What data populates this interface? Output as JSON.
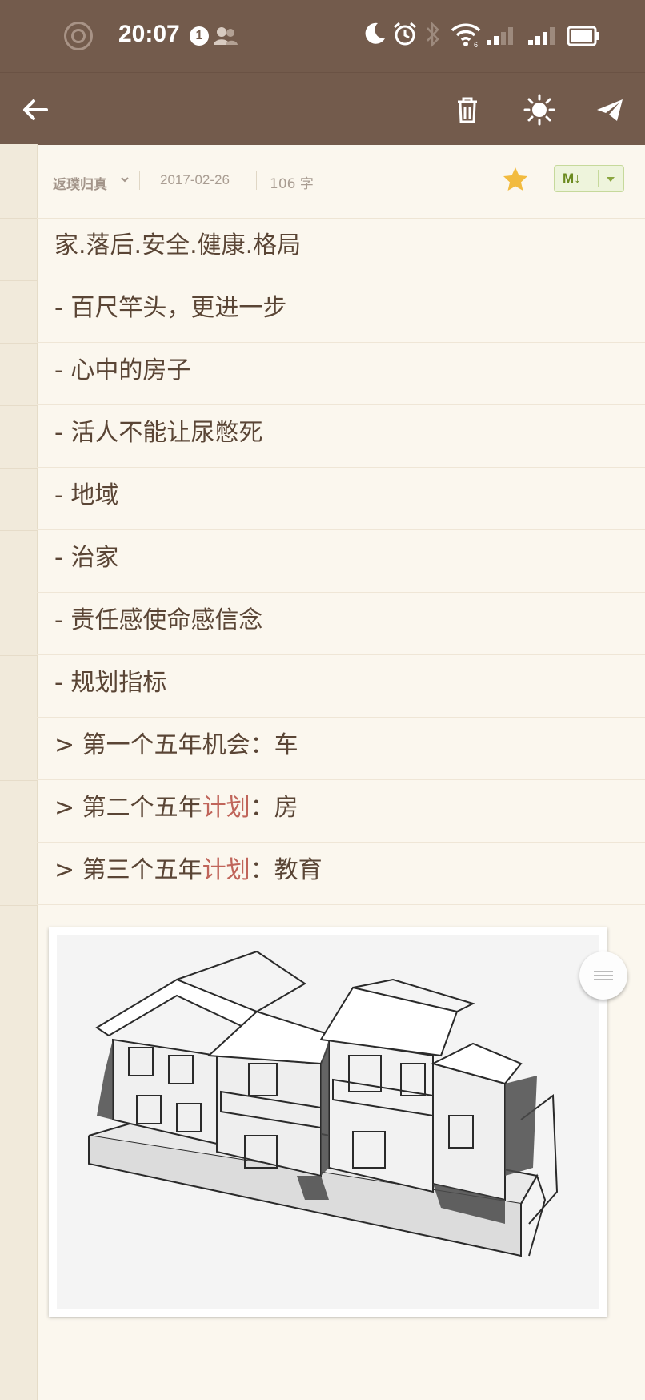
{
  "status_bar": {
    "time": "20:07",
    "notification_count": "1",
    "icons": [
      "app-ring-icon",
      "notification-badge",
      "contacts-icon",
      "moon-icon",
      "alarm-icon",
      "bluetooth-icon",
      "wifi-icon",
      "signal-icon",
      "signal-icon",
      "battery-icon"
    ]
  },
  "toolbar": {
    "icons": [
      "back-arrow-icon",
      "trash-icon",
      "sun-icon",
      "send-icon"
    ]
  },
  "note_meta": {
    "notebook": "返璞归真",
    "date": "2017-02-26",
    "word_count": "106 字",
    "starred": true,
    "format_label": "M↓"
  },
  "note_lines": [
    {
      "text": "家.落后.安全.健康.格局"
    },
    {
      "text": "- 百尺竿头，更进一步"
    },
    {
      "text": "- 心中的房子"
    },
    {
      "text": "- 活人不能让尿憋死"
    },
    {
      "text": "- 地域"
    },
    {
      "text": "- 治家"
    },
    {
      "text": "- 责任感使命感信念"
    },
    {
      "text": "- 规划指标"
    },
    {
      "text": "> 第一个五年机会：车"
    },
    {
      "prefix": "> 第二个五年",
      "highlight": "计划",
      "suffix": "：房"
    },
    {
      "prefix": "> 第三个五年",
      "highlight": "计划",
      "suffix": "：教育"
    }
  ],
  "colors": {
    "bar": "#735b4c",
    "paper": "#fbf7ee",
    "text": "#5a4535",
    "highlight": "#c0655a",
    "star": "#f2bb3f",
    "md_green": "#6b8a1f"
  }
}
